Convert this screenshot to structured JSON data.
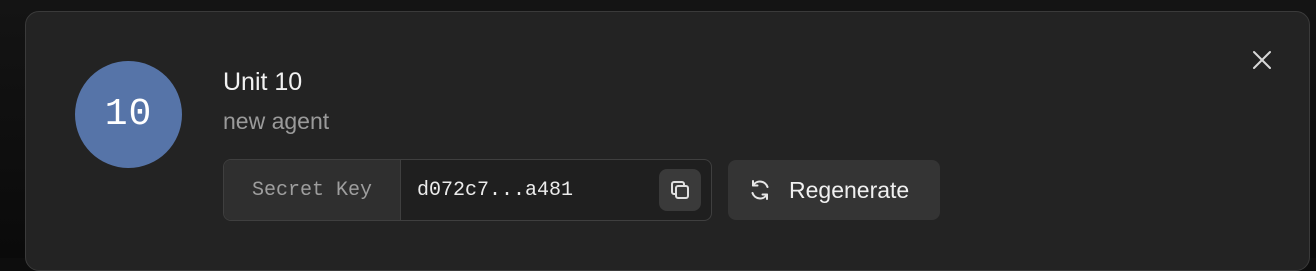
{
  "dialog": {
    "avatar_text": "10",
    "agent_name": "Unit 10",
    "agent_subtitle": "new agent",
    "close_icon": "close-icon",
    "secret_key": {
      "label": "Secret Key",
      "value": "d072c7...a481",
      "copy_icon": "copy-icon"
    },
    "regenerate": {
      "label": "Regenerate",
      "icon": "refresh-icon"
    }
  },
  "colors": {
    "avatar_background": "#5674a8",
    "dialog_background": "#232323",
    "button_background": "#343434"
  }
}
